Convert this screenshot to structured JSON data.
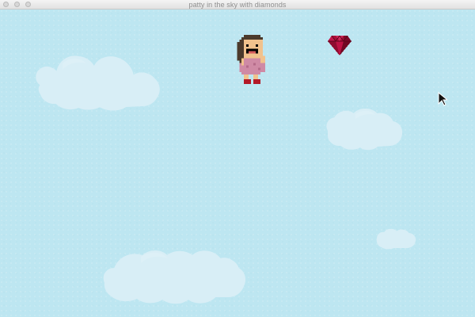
{
  "window": {
    "title": "patty in the sky with diamonds"
  },
  "icons": {
    "close": "window-close-icon",
    "minimize": "window-minimize-icon",
    "zoom": "window-zoom-icon",
    "cursor": "mouse-pointer-icon"
  },
  "colors": {
    "sky": "#bde6f1",
    "cloud": "#d8eef6",
    "title_text": "#8f8f8f",
    "diamond": "#a80f38",
    "dress": "#cf8aa5",
    "hair": "#4b3a2c",
    "skin": "#f1c28d",
    "shoe": "#b31927"
  },
  "scene": {
    "characters": [
      {
        "name": "patty",
        "sprite": "pixel-girl-pink-dress"
      }
    ],
    "collectibles": [
      {
        "type": "diamond",
        "color": "#a80f38"
      }
    ],
    "clouds": 4
  }
}
